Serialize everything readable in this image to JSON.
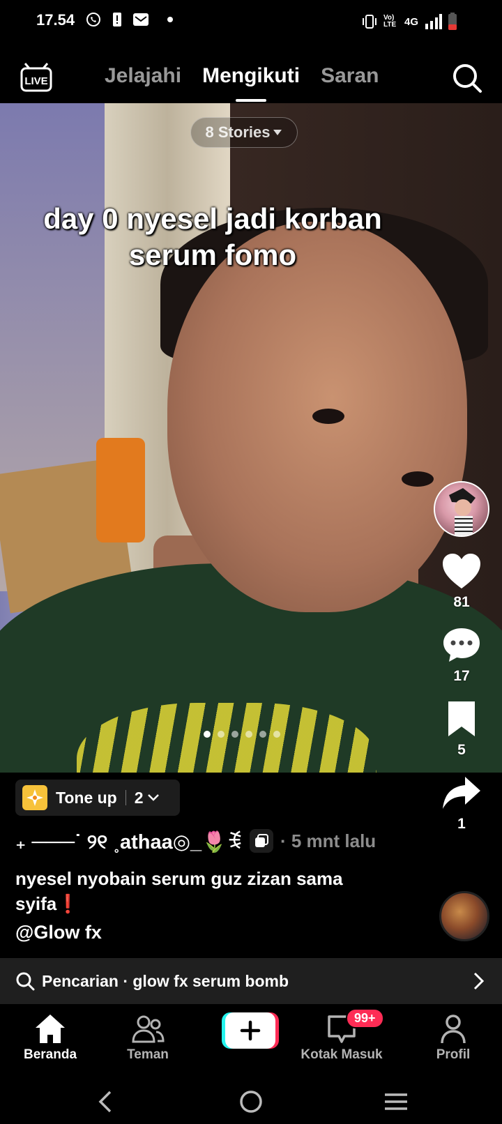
{
  "status_bar": {
    "time": "17.54",
    "network": "4G",
    "volte": "Vo) LTE"
  },
  "header": {
    "live_label": "LIVE",
    "tabs": [
      {
        "label": "Jelajahi",
        "active": false
      },
      {
        "label": "Mengikuti",
        "active": true
      },
      {
        "label": "Saran",
        "active": false
      }
    ]
  },
  "video": {
    "stories_label": "8 Stories",
    "overlay_caption": "day 0 nyesel jadi korban serum fomo",
    "carousel": {
      "count": 6,
      "active_index": 0
    }
  },
  "actions": {
    "likes": "81",
    "comments": "17",
    "saves": "5",
    "shares": "1"
  },
  "effect": {
    "name": "Tone up",
    "count": "2"
  },
  "post": {
    "username": "₊ ───˙ ୨୧ ˳athaa◎_🌷ꉂ",
    "time_ago": "· 5 mnt lalu",
    "description": "nyesel nyobain serum guz zizan sama syifa❗",
    "mention": "@Glow fx"
  },
  "search_suggestion": {
    "text": "Pencarian · glow fx serum bomb"
  },
  "bottom_nav": {
    "items": [
      {
        "label": "Beranda",
        "active": true
      },
      {
        "label": "Teman",
        "active": false
      },
      {
        "label": "Kotak Masuk",
        "active": false
      },
      {
        "label": "Profil",
        "active": false
      }
    ],
    "inbox_badge": "99+"
  },
  "colors": {
    "accent_red": "#fe2c55",
    "accent_cyan": "#25f4ee",
    "effect_yellow": "#f7c23a"
  }
}
